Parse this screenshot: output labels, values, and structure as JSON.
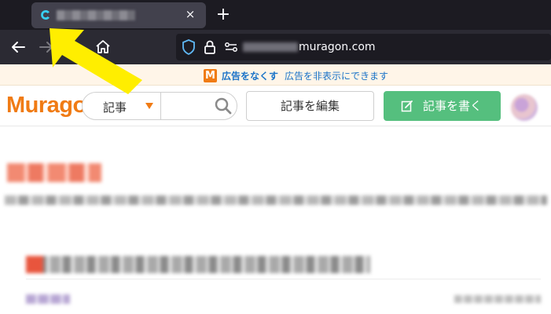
{
  "browser": {
    "tab": {
      "close_label": "×",
      "favicon": "muragon-c-icon"
    },
    "new_tab_label": "+",
    "nav": {
      "back_icon": "back-arrow-icon",
      "forward_icon": "forward-arrow-icon",
      "home_icon": "home-icon"
    },
    "urlbar": {
      "domain": "muragon.com",
      "shield_icon": "shield-icon",
      "lock_icon": "lock-icon",
      "permissions_icon": "permissions-icon"
    }
  },
  "ad_bar": {
    "badge": "M",
    "link": "広告をなくす",
    "description": "広告を非表示にできます"
  },
  "header": {
    "logo": "Muragon",
    "search": {
      "category_label": "記事",
      "placeholder": ""
    },
    "edit_button": "記事を編集",
    "write_button": "記事を書く"
  },
  "colors": {
    "brand_orange": "#f07b14",
    "write_green": "#55bf7e",
    "annotation_yellow": "#ffee00"
  }
}
